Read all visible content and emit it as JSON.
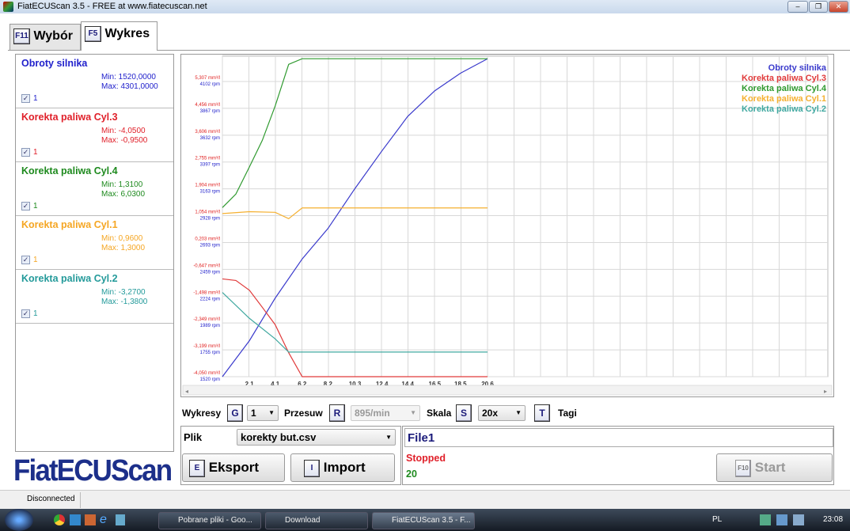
{
  "window": {
    "title": "FiatECUScan 3.5 - FREE at www.fiatecuscan.net",
    "min": "–",
    "max": "❐",
    "close": "✕"
  },
  "tabs": [
    {
      "key": "F11",
      "label": "Wybór"
    },
    {
      "key": "F5",
      "label": "Wykres"
    }
  ],
  "signals": [
    {
      "name": "Obroty silnika",
      "min": "Min: 1520,0000",
      "max": "Max: 4301,0000",
      "check": "1",
      "color": "#2222cc"
    },
    {
      "name": "Korekta paliwa Cyl.3",
      "min": "Min: -4,0500",
      "max": "Max: -0,9500",
      "check": "1",
      "color": "#e0202a"
    },
    {
      "name": "Korekta paliwa Cyl.4",
      "min": "Min: 1,3100",
      "max": "Max: 6,0300",
      "check": "1",
      "color": "#1e8a1e"
    },
    {
      "name": "Korekta paliwa Cyl.1",
      "min": "Min: 0,9600",
      "max": "Max: 1,3000",
      "check": "1",
      "color": "#f5a623"
    },
    {
      "name": "Korekta paliwa Cyl.2",
      "min": "Min: -3,2700",
      "max": "Max: -1,3800",
      "check": "1",
      "color": "#239a9a"
    }
  ],
  "chart_data": {
    "type": "line",
    "x_ticks": [
      "2,1",
      "4,1",
      "6,2",
      "8,2",
      "10,3",
      "12,4",
      "14,4",
      "16,5",
      "18,5",
      "20,6"
    ],
    "x_tick_values": [
      2.1,
      4.1,
      6.2,
      8.2,
      10.3,
      12.4,
      14.4,
      16.5,
      18.5,
      20.6
    ],
    "xlim": [
      0,
      47
    ],
    "y_left_ticks_corr": [
      "5,307 mm³/l",
      "4,456 mm³/l",
      "3,606 mm³/l",
      "2,755 mm³/l",
      "1,904 mm³/l",
      "1,054 mm³/l",
      "0,203 mm³/l",
      "-0,647 mm³/l",
      "-1,498 mm³/l",
      "-2,349 mm³/l",
      "-3,199 mm³/l",
      "-4,050 mm³/l"
    ],
    "y_left_ticks_rpm": [
      "4102 rpm",
      "3867 rpm",
      "3632 rpm",
      "3397 rpm",
      "3163 rpm",
      "2928 rpm",
      "2693 rpm",
      "2459 rpm",
      "2224 rpm",
      "1989 rpm",
      "1755 rpm",
      "1520 rpm"
    ],
    "rpm_range": [
      1520,
      4102
    ],
    "corr_range": [
      -4.05,
      5.307
    ],
    "legend_position": "top-right",
    "series": [
      {
        "name": "Obroty silnika",
        "axis": "rpm",
        "color": "#3a3acc",
        "x": [
          0,
          2.1,
          4.1,
          6.2,
          8.2,
          10.3,
          12.4,
          14.4,
          16.5,
          18.5,
          20.6
        ],
        "y": [
          1520,
          1835,
          2207,
          2550,
          2816,
          3166,
          3496,
          3797,
          4021,
          4175,
          4301
        ]
      },
      {
        "name": "Korekta paliwa Cyl.3",
        "axis": "corr",
        "color": "#e03a3a",
        "x": [
          0,
          1.05,
          2.1,
          3.1,
          4.1,
          5.15,
          6.2,
          20.6
        ],
        "y": [
          -0.95,
          -1.0,
          -1.31,
          -1.85,
          -2.4,
          -3.29,
          -4.05,
          -4.05
        ]
      },
      {
        "name": "Korekta paliwa Cyl.4",
        "axis": "corr",
        "color": "#2f9a2f",
        "x": [
          0,
          1.05,
          2.1,
          3.1,
          4.1,
          5.15,
          6.2,
          20.6
        ],
        "y": [
          1.31,
          1.74,
          2.6,
          3.44,
          4.53,
          5.85,
          6.03,
          6.03
        ]
      },
      {
        "name": "Korekta paliwa Cyl.1",
        "axis": "corr",
        "color": "#f5b030",
        "x": [
          0,
          2.1,
          4.1,
          5.15,
          6.2,
          20.6
        ],
        "y": [
          1.12,
          1.18,
          1.16,
          0.96,
          1.3,
          1.3
        ]
      },
      {
        "name": "Korekta paliwa Cyl.2",
        "axis": "corr",
        "color": "#40a8a0",
        "x": [
          0,
          2.1,
          4.1,
          5.15,
          6.2,
          20.6
        ],
        "y": [
          -1.38,
          -2.2,
          -2.85,
          -3.27,
          -3.27,
          -3.27
        ]
      }
    ]
  },
  "controls": {
    "wykresy_label": "Wykresy",
    "wykresy_key": "G",
    "wykresy_value": "1",
    "przesuw_label": "Przesuw",
    "przesuw_key": "R",
    "przesuw_value": "895/min",
    "skala_label": "Skala",
    "skala_key": "S",
    "skala_value": "20x",
    "tagi_key": "T",
    "tagi_label": "Tagi"
  },
  "file": {
    "label": "Plik",
    "value": "korekty but.csv",
    "export_key": "E",
    "export": "Eksport",
    "import_key": "I",
    "import": "Import"
  },
  "status": {
    "name": "File1",
    "state": "Stopped",
    "count": "20",
    "start_key": "F10",
    "start": "Start"
  },
  "logo": "FiatECUScan",
  "statusbar": "Disconnected",
  "taskbar": {
    "items": [
      "Pobrane pliki - Goo...",
      "Download",
      "FiatECUScan 3.5 - F..."
    ],
    "lang": "PL",
    "clock": "23:08"
  }
}
